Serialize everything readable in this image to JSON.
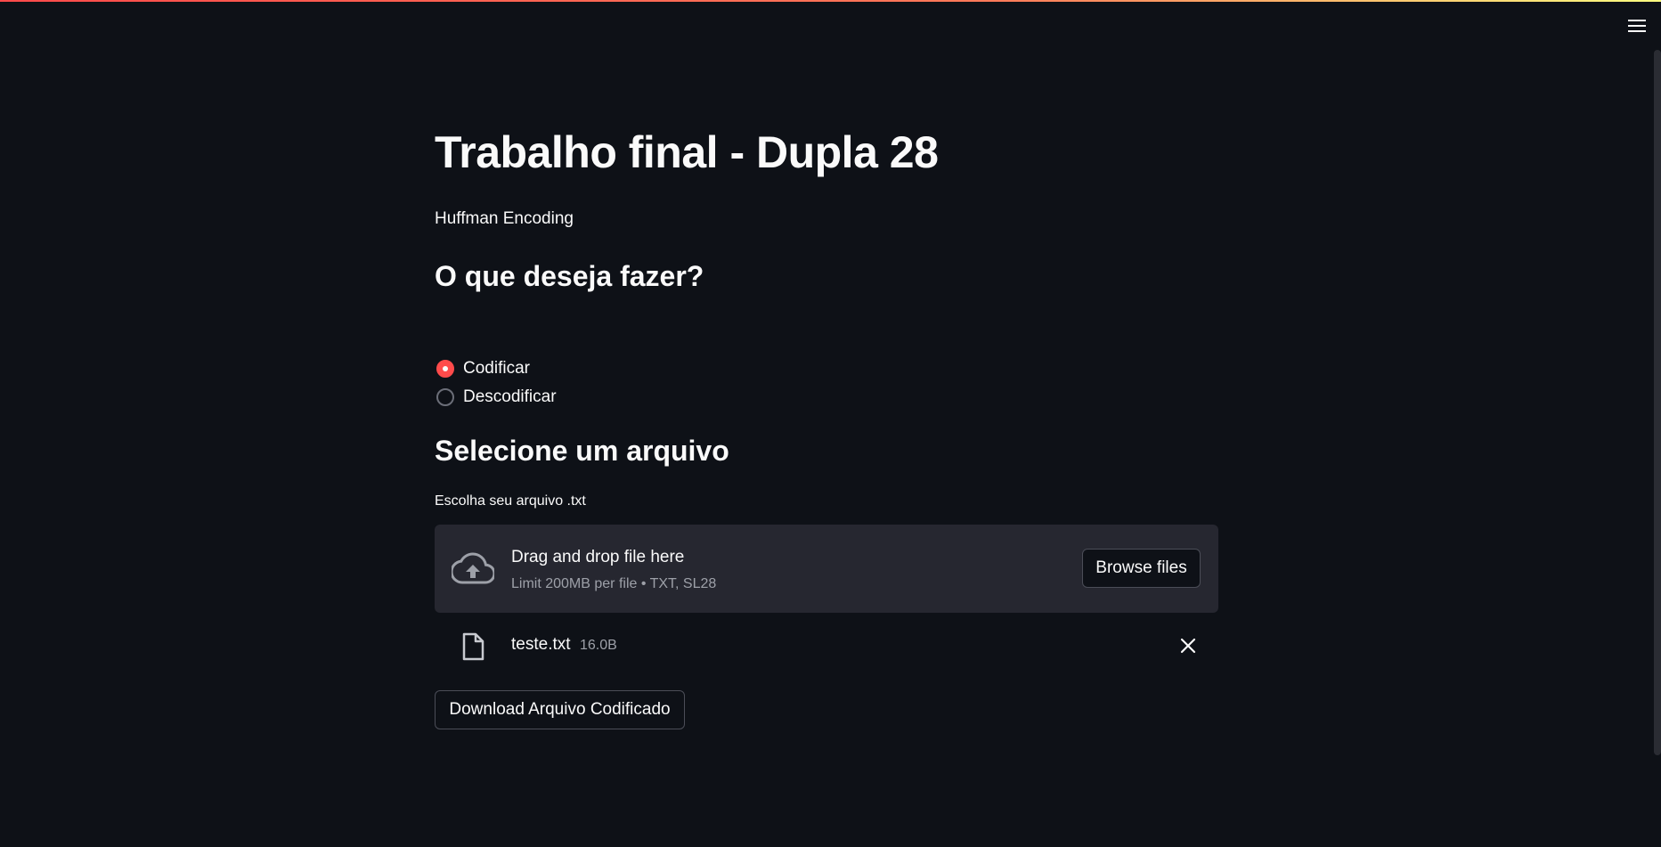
{
  "header": {
    "menu_icon": "hamburger-menu-icon",
    "accent_gradient": [
      "#ff4b4b",
      "#ff7a59",
      "#fffd80"
    ]
  },
  "main": {
    "title": "Trabalho final - Dupla 28",
    "subtitle": "Huffman Encoding",
    "question_heading": "O que deseja fazer?",
    "options": [
      {
        "label": "Codificar",
        "checked": true
      },
      {
        "label": "Descodificar",
        "checked": false
      }
    ],
    "file_heading": "Selecione um arquivo",
    "uploader": {
      "label": "Escolha seu arquivo .txt",
      "drop_text": "Drag and drop file here",
      "limit_text": "Limit 200MB per file • TXT, SL28",
      "browse_label": "Browse files",
      "icon": "cloud-upload-icon"
    },
    "uploaded_file": {
      "name": "teste.txt",
      "size": "16.0B",
      "icon": "file-icon",
      "remove_icon": "close-icon"
    },
    "download_label": "Download Arquivo Codificado"
  },
  "colors": {
    "background": "#0e1117",
    "surface": "#262730",
    "accent": "#ff4b4b",
    "text": "#fafafa",
    "muted": "#9da0a8"
  }
}
